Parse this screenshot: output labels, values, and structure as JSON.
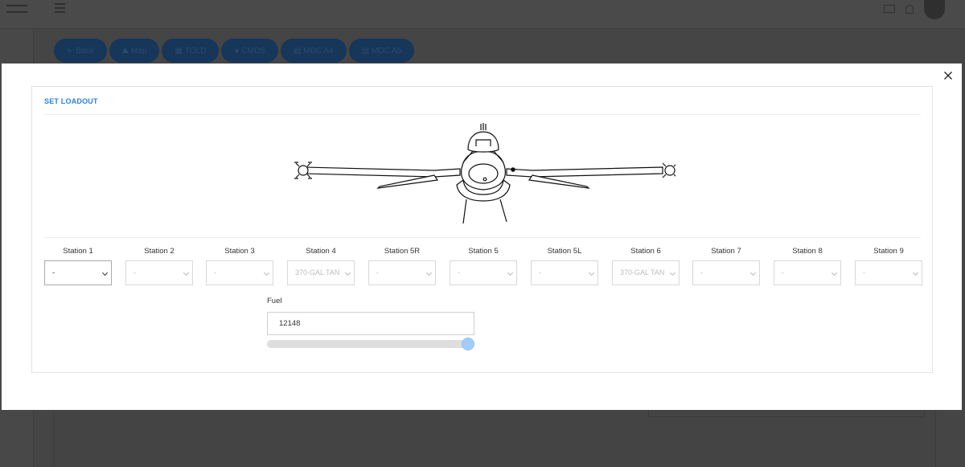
{
  "background": {
    "tabs": [
      {
        "icon": "arrow-left-icon",
        "glyph": "⇐",
        "label": "Back"
      },
      {
        "icon": "map-icon",
        "glyph": "⛰",
        "label": "Map"
      },
      {
        "icon": "calculator-icon",
        "glyph": "▦",
        "label": "TOLD"
      },
      {
        "icon": "globe-icon",
        "glyph": "●",
        "label": "CMDS"
      },
      {
        "icon": "document-icon",
        "glyph": "▤",
        "label": "MDC A4"
      },
      {
        "icon": "document-icon",
        "glyph": "▤",
        "label": "MDC A5"
      }
    ]
  },
  "modal": {
    "title": "SET LOADOUT",
    "stations": [
      {
        "label": "Station 1",
        "value": "-",
        "enabled": true
      },
      {
        "label": "Station 2",
        "value": "-",
        "enabled": false
      },
      {
        "label": "Station 3",
        "value": "-",
        "enabled": false
      },
      {
        "label": "Station 4",
        "value": "370-GAL TAN",
        "enabled": false
      },
      {
        "label": "Station 5R",
        "value": "-",
        "enabled": false
      },
      {
        "label": "Station 5",
        "value": "-",
        "enabled": false
      },
      {
        "label": "Station 5L",
        "value": "-",
        "enabled": false
      },
      {
        "label": "Station 6",
        "value": "370-GAL TAN",
        "enabled": false
      },
      {
        "label": "Station 7",
        "value": "-",
        "enabled": false
      },
      {
        "label": "Station 8",
        "value": "-",
        "enabled": false
      },
      {
        "label": "Station 9",
        "value": "-",
        "enabled": false
      }
    ],
    "fuel": {
      "label": "Fuel",
      "value": "12148",
      "slider_fraction": 1.0
    }
  },
  "colors": {
    "accent": "#2e7ee0",
    "tab_bg": "#16365a",
    "slider_thumb": "#a3ccf8"
  }
}
